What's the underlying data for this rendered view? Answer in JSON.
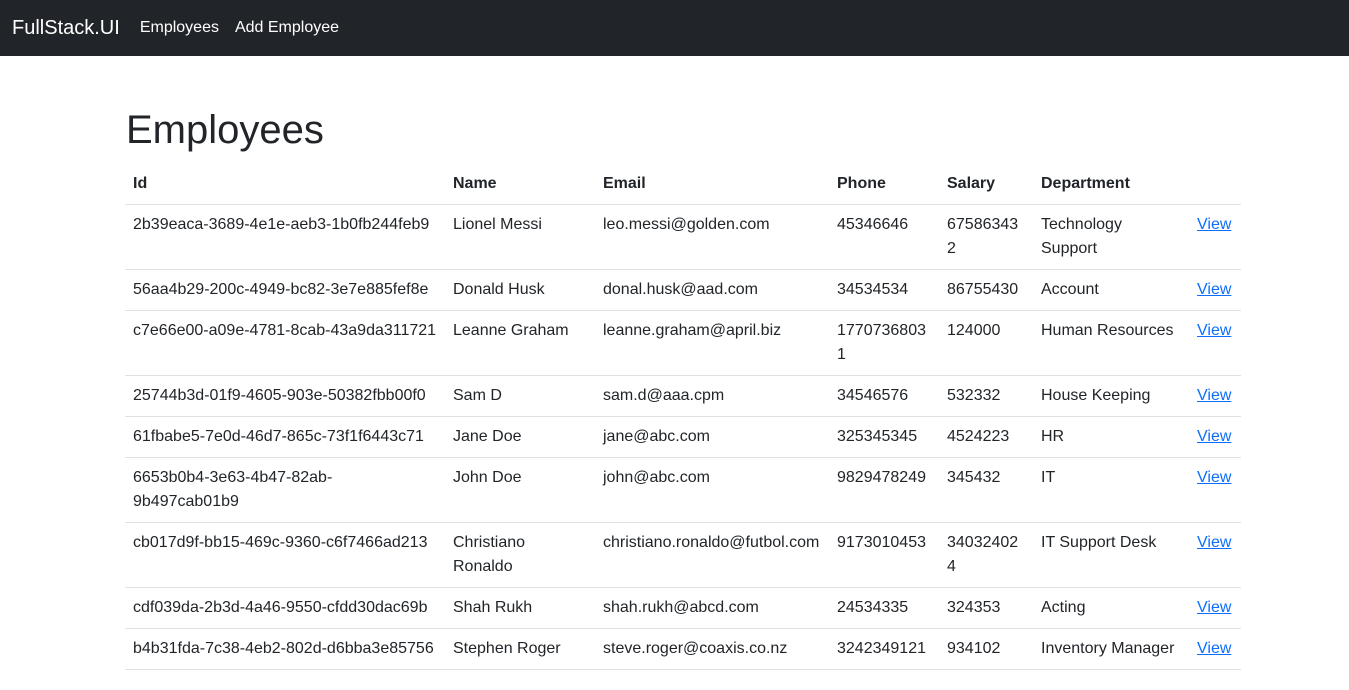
{
  "navbar": {
    "brand": "FullStack.UI",
    "links": [
      "Employees",
      "Add Employee"
    ]
  },
  "page": {
    "title": "Employees"
  },
  "table": {
    "headers": [
      "Id",
      "Name",
      "Email",
      "Phone",
      "Salary",
      "Department",
      ""
    ],
    "action_label": "View",
    "rows": [
      [
        "2b39eaca-3689-4e1e-aeb3-1b0fb244feb9",
        "Lionel Messi",
        "leo.messi@golden.com",
        "45346646",
        "675863432",
        "Technology Support"
      ],
      [
        "56aa4b29-200c-4949-bc82-3e7e885fef8e",
        "Donald Husk",
        "donal.husk@aad.com",
        "34534534",
        "86755430",
        "Account"
      ],
      [
        "c7e66e00-a09e-4781-8cab-43a9da311721",
        "Leanne Graham",
        "leanne.graham@april.biz",
        "17707368031",
        "124000",
        "Human Resources"
      ],
      [
        "25744b3d-01f9-4605-903e-50382fbb00f0",
        "Sam D",
        "sam.d@aaa.cpm",
        "34546576",
        "532332",
        "House Keeping"
      ],
      [
        "61fbabe5-7e0d-46d7-865c-73f1f6443c71",
        "Jane Doe",
        "jane@abc.com",
        "325345345",
        "4524223",
        "HR"
      ],
      [
        "6653b0b4-3e63-4b47-82ab-9b497cab01b9",
        "John Doe",
        "john@abc.com",
        "9829478249",
        "345432",
        "IT"
      ],
      [
        "cb017d9f-bb15-469c-9360-c6f7466ad213",
        "Christiano Ronaldo",
        "christiano.ronaldo@futbol.com",
        "9173010453",
        "340324024",
        "IT Support Desk"
      ],
      [
        "cdf039da-2b3d-4a46-9550-cfdd30dac69b",
        "Shah Rukh",
        "shah.rukh@abcd.com",
        "24534335",
        "324353",
        "Acting"
      ],
      [
        "b4b31fda-7c38-4eb2-802d-d6bba3e85756",
        "Stephen Roger",
        "steve.roger@coaxis.co.nz",
        "3242349121",
        "934102",
        "Inventory Manager"
      ]
    ]
  }
}
